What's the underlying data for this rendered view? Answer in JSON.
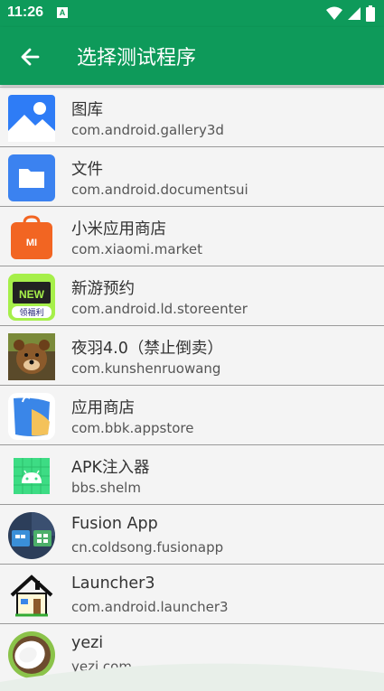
{
  "status": {
    "time": "11:26",
    "notif_letter": "A"
  },
  "header": {
    "title": "选择测试程序"
  },
  "apps": [
    {
      "name": "图库",
      "package": "com.android.gallery3d",
      "icon": "gallery-icon"
    },
    {
      "name": "文件",
      "package": "com.android.documentsui",
      "icon": "folder-icon"
    },
    {
      "name": "小米应用商店",
      "package": "com.xiaomi.market",
      "icon": "xiaomi-market-icon",
      "icon_text": "MI"
    },
    {
      "name": "新游预约",
      "package": "com.android.ld.storeenter",
      "icon": "new-game-icon",
      "icon_text": "NEW",
      "icon_subtext": "领福利"
    },
    {
      "name": "夜羽4.0（禁止倒卖）",
      "package": "com.kunshenruowang",
      "icon": "bear-avatar-icon"
    },
    {
      "name": "应用商店",
      "package": "com.bbk.appstore",
      "icon": "app-store-bag-icon"
    },
    {
      "name": "APK注入器",
      "package": "bbs.shelm",
      "icon": "android-icon"
    },
    {
      "name": "Fusion App",
      "package": "cn.coldsong.fusionapp",
      "icon": "fusion-app-icon"
    },
    {
      "name": "Launcher3",
      "package": "com.android.launcher3",
      "icon": "house-icon"
    },
    {
      "name": "yezi",
      "package": "yezi.com",
      "icon": "coconut-icon"
    }
  ],
  "colors": {
    "primary": "#0e9a5a",
    "background": "#f4f4f4",
    "divider": "#9a9a9a"
  }
}
